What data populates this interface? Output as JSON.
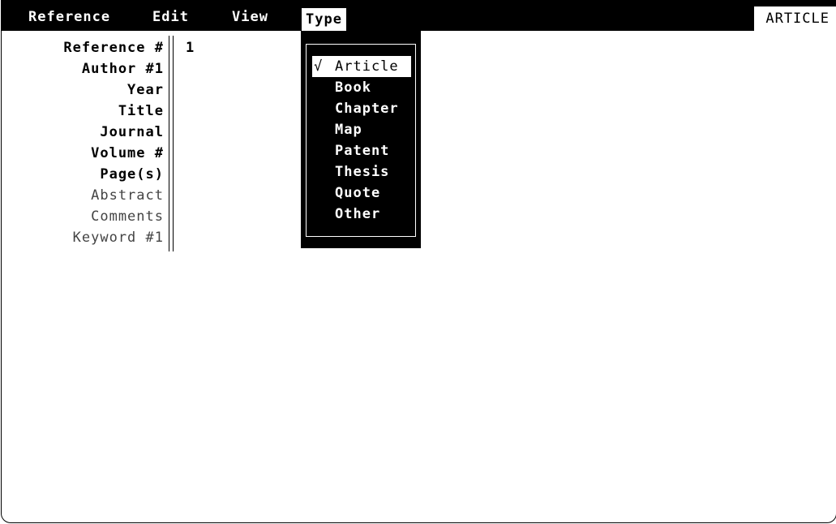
{
  "menubar": {
    "items": [
      {
        "label": "Reference"
      },
      {
        "label": "Edit"
      },
      {
        "label": "View"
      },
      {
        "label": "Type"
      }
    ],
    "mode": "ARTICLE"
  },
  "fields": [
    {
      "label": "Reference #",
      "value": "1"
    },
    {
      "label": "Author #1"
    },
    {
      "label": "Year"
    },
    {
      "label": "Title"
    },
    {
      "label": "Journal"
    },
    {
      "label": "Volume #"
    },
    {
      "label": "Page(s)"
    },
    {
      "label": "Abstract"
    },
    {
      "label": "Comments"
    },
    {
      "label": "Keyword #1"
    }
  ],
  "type_menu": {
    "check_mark": "√",
    "items": [
      {
        "label": "Article",
        "selected": true
      },
      {
        "label": "Book"
      },
      {
        "label": "Chapter"
      },
      {
        "label": "Map"
      },
      {
        "label": "Patent"
      },
      {
        "label": "Thesis"
      },
      {
        "label": "Quote"
      },
      {
        "label": "Other"
      }
    ]
  }
}
